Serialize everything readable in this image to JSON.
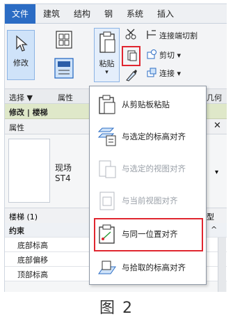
{
  "ribbon_tabs": [
    "文件",
    "建筑",
    "结构",
    "钢",
    "系统",
    "插入"
  ],
  "ribbon": {
    "modify_label": "修改",
    "paste_label": "粘贴",
    "cope_label": "连接端切割",
    "cut_label": "剪切",
    "join_label": "连接"
  },
  "panel_row": {
    "select": "选择 ▼",
    "properties": "属性",
    "geometry": "几何图"
  },
  "context_bar": "修改 | 楼梯",
  "properties": {
    "title": "属性",
    "type_line1": "现场",
    "type_line2": "ST4",
    "list_header": "楼梯 (1)",
    "list_header_right": "型",
    "rows": [
      "约束",
      "底部标高",
      "底部偏移",
      "顶部标高"
    ]
  },
  "paste_menu": {
    "items": [
      {
        "label": "从剪贴板粘贴",
        "enabled": true,
        "icon": "clipboard-icon"
      },
      {
        "label": "与选定的标高对齐",
        "enabled": true,
        "icon": "align-levels-icon"
      },
      {
        "label": "与选定的视图对齐",
        "enabled": false,
        "icon": "align-views-icon"
      },
      {
        "label": "与当前视图对齐",
        "enabled": false,
        "icon": "align-current-view-icon"
      },
      {
        "label": "与同一位置对齐",
        "enabled": true,
        "icon": "align-same-place-icon"
      },
      {
        "label": "与拾取的标高对齐",
        "enabled": true,
        "icon": "align-picked-level-icon"
      }
    ]
  },
  "caption": "图 2",
  "colors": {
    "accent": "#2b6cc4",
    "highlight": "#e0252f"
  }
}
